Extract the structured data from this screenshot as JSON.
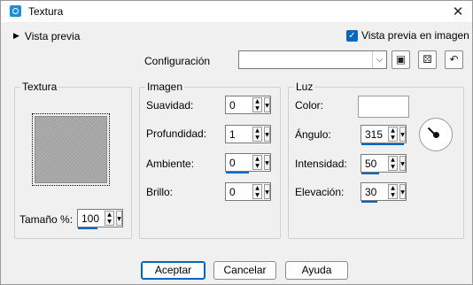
{
  "window": {
    "title": "Textura",
    "close_glyph": "✕"
  },
  "preview": {
    "toggle_label": "Vista previa",
    "checkbox_label": "Vista previa en imagen",
    "checkbox_checked": true
  },
  "config": {
    "label": "Configuración",
    "value": ""
  },
  "toolbar": {
    "save_icon": "💾",
    "random_icon": "⚄",
    "reset_icon": "↶"
  },
  "groups": {
    "texture": {
      "title": "Textura",
      "size_label": "Tamaño %:",
      "size_value": "100"
    },
    "image": {
      "title": "Imagen",
      "fields": [
        {
          "label": "Suavidad:",
          "value": "0"
        },
        {
          "label": "Profundidad:",
          "value": "1"
        },
        {
          "label": "Ambiente:",
          "value": "0"
        },
        {
          "label": "Brillo:",
          "value": "0"
        }
      ]
    },
    "light": {
      "title": "Luz",
      "color_label": "Color:",
      "color_value": "#ffffff",
      "fields": [
        {
          "label": "Ángulo:",
          "value": "315"
        },
        {
          "label": "Intensidad:",
          "value": "50"
        },
        {
          "label": "Elevación:",
          "value": "30"
        }
      ]
    }
  },
  "buttons": {
    "ok": "Aceptar",
    "cancel": "Cancelar",
    "help": "Ayuda"
  },
  "colors": {
    "accent": "#0067c0",
    "window_bg": "#f0f0f0"
  }
}
